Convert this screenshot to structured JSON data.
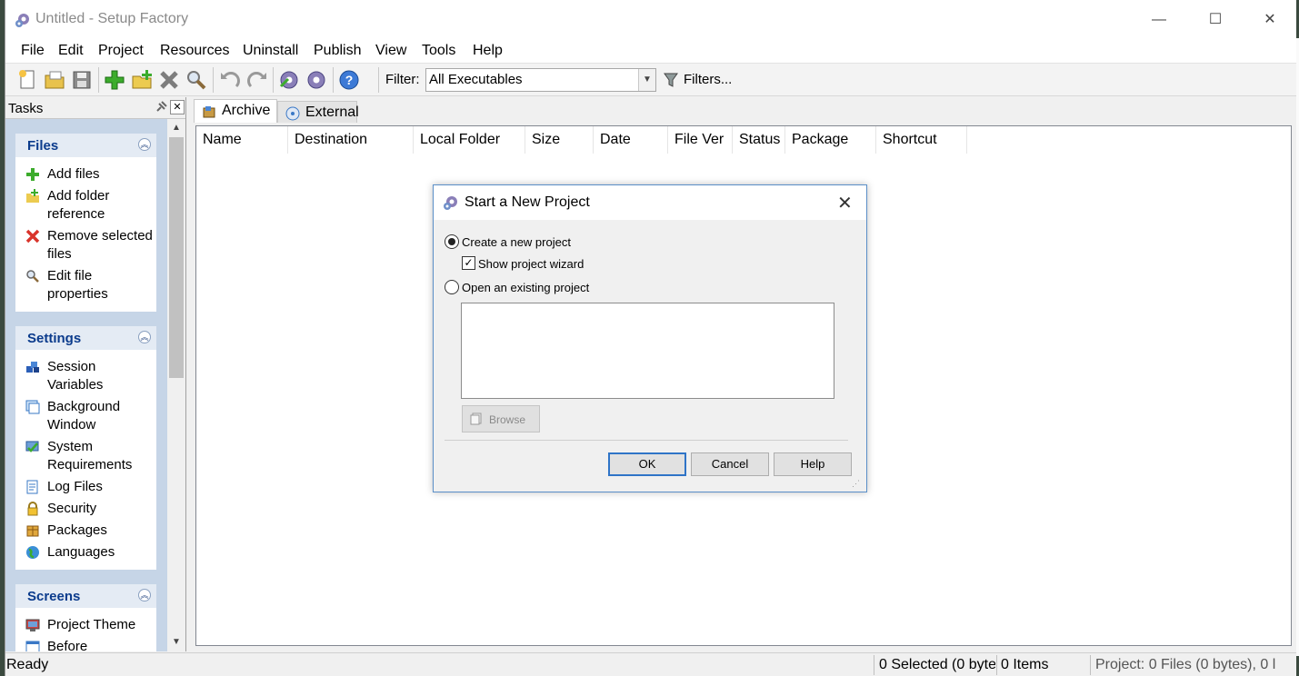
{
  "window": {
    "title": "Untitled - Setup Factory",
    "controls": [
      "—",
      "☐",
      "✕"
    ]
  },
  "menu": [
    "File",
    "Edit",
    "Project",
    "Resources",
    "Uninstall",
    "Publish",
    "View",
    "Tools",
    "Help"
  ],
  "toolbar": {
    "buttons": [
      "new-project-icon",
      "open-project-icon",
      "save-icon",
      "add-files-icon",
      "add-folder-icon",
      "remove-icon",
      "file-properties-icon",
      "undo-icon",
      "redo-icon",
      "build-icon",
      "publish-settings-icon",
      "help-icon"
    ],
    "filter_label": "Filter:",
    "filter_value": "All Executables",
    "filters_button": "Filters..."
  },
  "taskpane": {
    "title": "Tasks",
    "groups": {
      "files": {
        "title": "Files",
        "items": [
          "Add files",
          "Add folder reference",
          "Remove selected files",
          "Edit file properties"
        ]
      },
      "settings": {
        "title": "Settings",
        "items": [
          "Session Variables",
          "Background Window",
          "System Requirements",
          "Log Files",
          "Security",
          "Packages",
          "Languages"
        ]
      },
      "screens": {
        "title": "Screens",
        "items": [
          "Project Theme",
          "Before"
        ]
      }
    }
  },
  "tabs": {
    "archive": "Archive",
    "external": "External"
  },
  "columns": [
    "Name",
    "Destination",
    "Local Folder",
    "Size",
    "Date",
    "File Ver",
    "Status",
    "Package",
    "Shortcut"
  ],
  "status": {
    "ready": "Ready",
    "selected": "0 Selected (0 byte",
    "items": "0 Items",
    "project": "Project: 0 Files (0 bytes), 0 l"
  },
  "dialog": {
    "title": "Start a New Project",
    "create_label": "Create a new project",
    "wizard_label": "Show project wizard",
    "open_label": "Open an existing project",
    "browse": "Browse",
    "ok": "OK",
    "cancel": "Cancel",
    "help": "Help",
    "create_selected": true,
    "wizard_checked": true
  },
  "colors": {
    "accent": "#2f74c7",
    "group_title": "#0b3b8c",
    "taskpane_bg": "#c6d5e7"
  }
}
